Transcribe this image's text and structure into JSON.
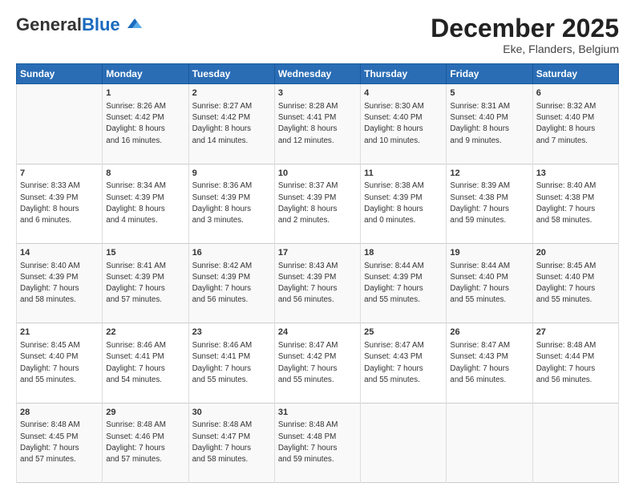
{
  "header": {
    "logo_general": "General",
    "logo_blue": "Blue",
    "month_title": "December 2025",
    "location": "Eke, Flanders, Belgium"
  },
  "days_of_week": [
    "Sunday",
    "Monday",
    "Tuesday",
    "Wednesday",
    "Thursday",
    "Friday",
    "Saturday"
  ],
  "weeks": [
    [
      {
        "day": "",
        "info": ""
      },
      {
        "day": "1",
        "info": "Sunrise: 8:26 AM\nSunset: 4:42 PM\nDaylight: 8 hours\nand 16 minutes."
      },
      {
        "day": "2",
        "info": "Sunrise: 8:27 AM\nSunset: 4:42 PM\nDaylight: 8 hours\nand 14 minutes."
      },
      {
        "day": "3",
        "info": "Sunrise: 8:28 AM\nSunset: 4:41 PM\nDaylight: 8 hours\nand 12 minutes."
      },
      {
        "day": "4",
        "info": "Sunrise: 8:30 AM\nSunset: 4:40 PM\nDaylight: 8 hours\nand 10 minutes."
      },
      {
        "day": "5",
        "info": "Sunrise: 8:31 AM\nSunset: 4:40 PM\nDaylight: 8 hours\nand 9 minutes."
      },
      {
        "day": "6",
        "info": "Sunrise: 8:32 AM\nSunset: 4:40 PM\nDaylight: 8 hours\nand 7 minutes."
      }
    ],
    [
      {
        "day": "7",
        "info": "Sunrise: 8:33 AM\nSunset: 4:39 PM\nDaylight: 8 hours\nand 6 minutes."
      },
      {
        "day": "8",
        "info": "Sunrise: 8:34 AM\nSunset: 4:39 PM\nDaylight: 8 hours\nand 4 minutes."
      },
      {
        "day": "9",
        "info": "Sunrise: 8:36 AM\nSunset: 4:39 PM\nDaylight: 8 hours\nand 3 minutes."
      },
      {
        "day": "10",
        "info": "Sunrise: 8:37 AM\nSunset: 4:39 PM\nDaylight: 8 hours\nand 2 minutes."
      },
      {
        "day": "11",
        "info": "Sunrise: 8:38 AM\nSunset: 4:39 PM\nDaylight: 8 hours\nand 0 minutes."
      },
      {
        "day": "12",
        "info": "Sunrise: 8:39 AM\nSunset: 4:38 PM\nDaylight: 7 hours\nand 59 minutes."
      },
      {
        "day": "13",
        "info": "Sunrise: 8:40 AM\nSunset: 4:38 PM\nDaylight: 7 hours\nand 58 minutes."
      }
    ],
    [
      {
        "day": "14",
        "info": "Sunrise: 8:40 AM\nSunset: 4:39 PM\nDaylight: 7 hours\nand 58 minutes."
      },
      {
        "day": "15",
        "info": "Sunrise: 8:41 AM\nSunset: 4:39 PM\nDaylight: 7 hours\nand 57 minutes."
      },
      {
        "day": "16",
        "info": "Sunrise: 8:42 AM\nSunset: 4:39 PM\nDaylight: 7 hours\nand 56 minutes."
      },
      {
        "day": "17",
        "info": "Sunrise: 8:43 AM\nSunset: 4:39 PM\nDaylight: 7 hours\nand 56 minutes."
      },
      {
        "day": "18",
        "info": "Sunrise: 8:44 AM\nSunset: 4:39 PM\nDaylight: 7 hours\nand 55 minutes."
      },
      {
        "day": "19",
        "info": "Sunrise: 8:44 AM\nSunset: 4:40 PM\nDaylight: 7 hours\nand 55 minutes."
      },
      {
        "day": "20",
        "info": "Sunrise: 8:45 AM\nSunset: 4:40 PM\nDaylight: 7 hours\nand 55 minutes."
      }
    ],
    [
      {
        "day": "21",
        "info": "Sunrise: 8:45 AM\nSunset: 4:40 PM\nDaylight: 7 hours\nand 55 minutes."
      },
      {
        "day": "22",
        "info": "Sunrise: 8:46 AM\nSunset: 4:41 PM\nDaylight: 7 hours\nand 54 minutes."
      },
      {
        "day": "23",
        "info": "Sunrise: 8:46 AM\nSunset: 4:41 PM\nDaylight: 7 hours\nand 55 minutes."
      },
      {
        "day": "24",
        "info": "Sunrise: 8:47 AM\nSunset: 4:42 PM\nDaylight: 7 hours\nand 55 minutes."
      },
      {
        "day": "25",
        "info": "Sunrise: 8:47 AM\nSunset: 4:43 PM\nDaylight: 7 hours\nand 55 minutes."
      },
      {
        "day": "26",
        "info": "Sunrise: 8:47 AM\nSunset: 4:43 PM\nDaylight: 7 hours\nand 56 minutes."
      },
      {
        "day": "27",
        "info": "Sunrise: 8:48 AM\nSunset: 4:44 PM\nDaylight: 7 hours\nand 56 minutes."
      }
    ],
    [
      {
        "day": "28",
        "info": "Sunrise: 8:48 AM\nSunset: 4:45 PM\nDaylight: 7 hours\nand 57 minutes."
      },
      {
        "day": "29",
        "info": "Sunrise: 8:48 AM\nSunset: 4:46 PM\nDaylight: 7 hours\nand 57 minutes."
      },
      {
        "day": "30",
        "info": "Sunrise: 8:48 AM\nSunset: 4:47 PM\nDaylight: 7 hours\nand 58 minutes."
      },
      {
        "day": "31",
        "info": "Sunrise: 8:48 AM\nSunset: 4:48 PM\nDaylight: 7 hours\nand 59 minutes."
      },
      {
        "day": "",
        "info": ""
      },
      {
        "day": "",
        "info": ""
      },
      {
        "day": "",
        "info": ""
      }
    ]
  ]
}
